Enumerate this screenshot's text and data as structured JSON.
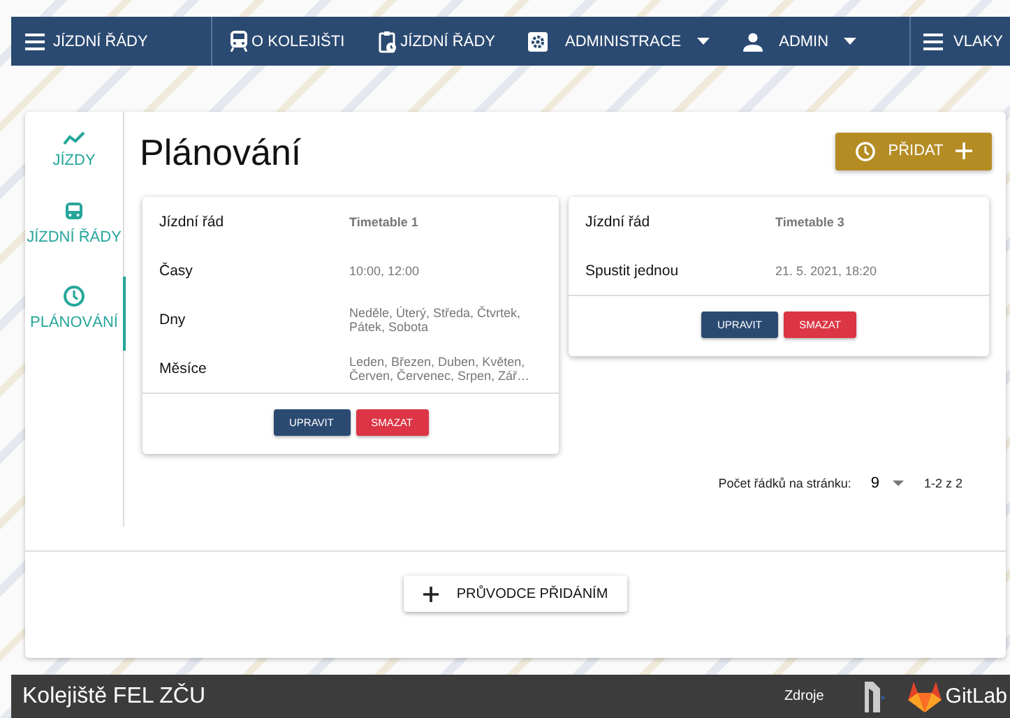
{
  "navbar": {
    "brand": "JÍZDNÍ ŘÁDY",
    "items": [
      {
        "label": "O KOLEJIŠTI",
        "dropdown": false
      },
      {
        "label": "JÍZDNÍ ŘÁDY",
        "dropdown": false
      },
      {
        "label": "ADMINISTRACE",
        "dropdown": true
      },
      {
        "label": "ADMIN",
        "dropdown": true
      }
    ],
    "right_item": "VLAKY"
  },
  "sidebar": {
    "items": [
      {
        "label": "JÍZDY",
        "selected": false
      },
      {
        "label": "JÍZDNÍ ŘÁDY",
        "selected": false
      },
      {
        "label": "PLÁNOVÁNÍ",
        "selected": true
      }
    ]
  },
  "page": {
    "title": "Plánování",
    "add_button": "PŘIDAT"
  },
  "cards": [
    {
      "rows": [
        {
          "label": "Jízdní řád",
          "value": "Timetable 1"
        },
        {
          "label": "Časy",
          "value": "10:00, 12:00"
        },
        {
          "label": "Dny",
          "value": "Neděle, Úterý, Středa, Čtvrtek, Pátek, Sobota"
        },
        {
          "label": "Měsíce",
          "value": "Leden, Březen, Duben, Květen, Červen, Červenec, Srpen, Zář…"
        }
      ],
      "buttons": [
        "UPRAVIT",
        "SMAZAT"
      ]
    },
    {
      "rows": [
        {
          "label": "Jízdní řád",
          "value": "Timetable 3"
        },
        {
          "label": "Spustit jednou",
          "value": "21. 5. 2021, 18:20"
        }
      ],
      "buttons": [
        "UPRAVIT",
        "SMAZAT"
      ]
    }
  ],
  "pagination": {
    "label": "Počet řádků na stránku:",
    "per_page": "9",
    "range": "1-2 z 2"
  },
  "wizard_button": "PRŮVODCE PŘIDÁNÍM",
  "footer": {
    "title": "Kolejiště FEL ZČU",
    "link": "Zdroje",
    "gitlab": "GitLab"
  }
}
